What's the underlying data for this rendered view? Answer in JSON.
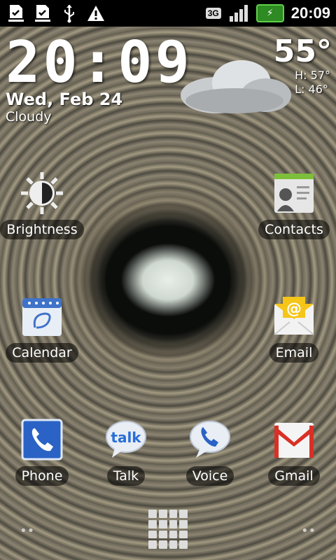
{
  "status_bar": {
    "left_icons": [
      "download-done-icon",
      "download-done-icon",
      "usb-icon",
      "warning-icon"
    ],
    "network": "3G",
    "time": "20:09"
  },
  "widget": {
    "time": "20:09",
    "date": "Wed, Feb 24",
    "condition": "Cloudy",
    "temperature": "55°",
    "high": "H:  57°",
    "low": "L:  46°"
  },
  "apps": {
    "brightness": "Brightness",
    "contacts": "Contacts",
    "calendar": "Calendar",
    "email": "Email",
    "phone": "Phone",
    "talk": "Talk",
    "voice": "Voice",
    "gmail": "Gmail"
  },
  "dock": {
    "left_dots": "••",
    "right_dots": "••"
  },
  "colors": {
    "battery": "#2e8a22",
    "accent": "#5fd24a"
  }
}
